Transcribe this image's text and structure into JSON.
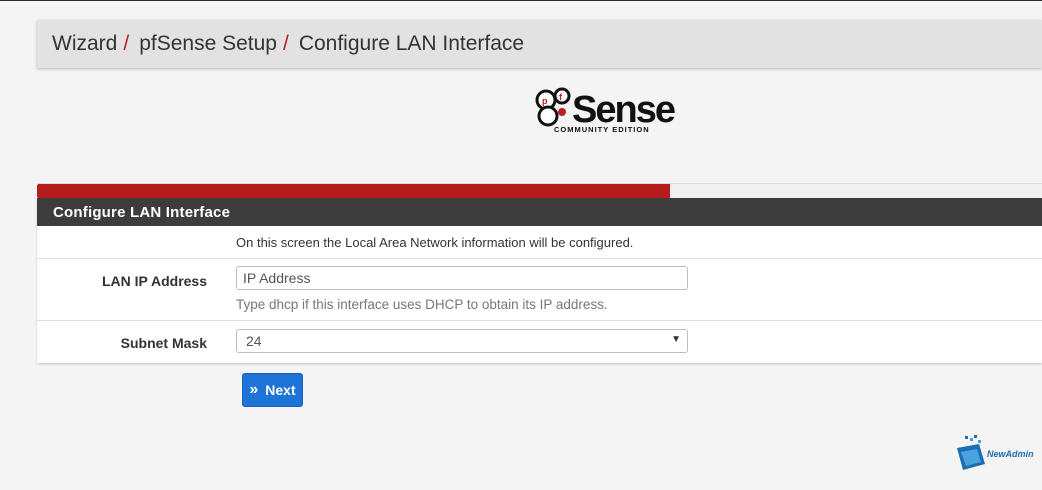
{
  "breadcrumb": {
    "items": [
      "Wizard",
      "pfSense Setup",
      "Configure LAN Interface"
    ],
    "separator": "/"
  },
  "logo": {
    "brand": "Sense",
    "tagline": "COMMUNITY EDITION"
  },
  "progress": {
    "percent": 63,
    "color": "#b71c1c"
  },
  "panel": {
    "title": "Configure LAN Interface",
    "intro": "On this screen the Local Area Network information will be configured.",
    "lan_ip": {
      "label": "LAN IP Address",
      "placeholder": "IP Address",
      "value": "",
      "help": "Type dhcp if this interface uses DHCP to obtain its IP address."
    },
    "subnet": {
      "label": "Subnet Mask",
      "selected": "24"
    }
  },
  "actions": {
    "next_label": "Next",
    "next_icon": "double-chevron-right-icon"
  },
  "watermark": {
    "text": "NewAdmin"
  },
  "colors": {
    "accent_red": "#b7211d",
    "panel_heading": "#3c3c3c",
    "button_blue": "#1e73d8"
  }
}
